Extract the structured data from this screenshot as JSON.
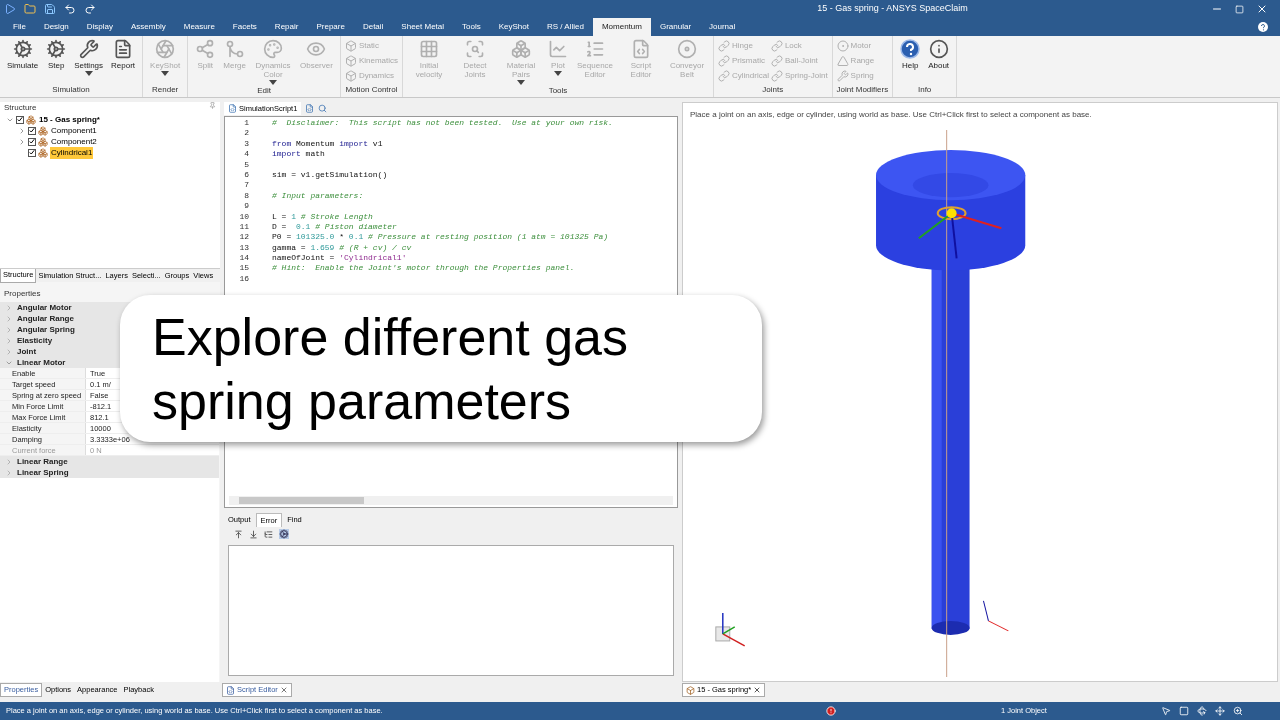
{
  "title_bar": {
    "title": "15 - Gas spring - ANSYS SpaceClaim"
  },
  "menu_tabs": [
    {
      "label": "File",
      "selected": false
    },
    {
      "label": "Design",
      "selected": false
    },
    {
      "label": "Display",
      "selected": false
    },
    {
      "label": "Assembly",
      "selected": false
    },
    {
      "label": "Measure",
      "selected": false
    },
    {
      "label": "Facets",
      "selected": false
    },
    {
      "label": "Repair",
      "selected": false
    },
    {
      "label": "Prepare",
      "selected": false
    },
    {
      "label": "Detail",
      "selected": false
    },
    {
      "label": "Sheet Metal",
      "selected": false
    },
    {
      "label": "Tools",
      "selected": false
    },
    {
      "label": "KeyShot",
      "selected": false
    },
    {
      "label": "RS / Allied",
      "selected": false
    },
    {
      "label": "Momentum",
      "selected": true
    },
    {
      "label": "Granular",
      "selected": false
    },
    {
      "label": "Journal",
      "selected": false
    }
  ],
  "ribbon_groups": [
    {
      "label": "Simulation",
      "columns": [
        [
          {
            "label": "Simulate",
            "kind": "large",
            "disabled": false,
            "dropdown": false
          }
        ],
        [
          {
            "label": "Step",
            "kind": "large",
            "disabled": false,
            "dropdown": false
          }
        ],
        [
          {
            "label": "Settings",
            "kind": "large",
            "disabled": false,
            "dropdown": true
          }
        ],
        [
          {
            "label": "Report",
            "kind": "large",
            "disabled": false,
            "dropdown": false
          }
        ]
      ]
    },
    {
      "label": "Render",
      "columns": [
        [
          {
            "label": "KeyShot",
            "kind": "large",
            "disabled": true,
            "dropdown": true
          }
        ]
      ]
    },
    {
      "label": "Edit",
      "columns": [
        [
          {
            "label": "Split",
            "kind": "large",
            "disabled": true,
            "dropdown": false
          }
        ],
        [
          {
            "label": "Merge",
            "kind": "large",
            "disabled": true,
            "dropdown": false
          }
        ],
        [
          {
            "label": "Dynamics Color",
            "kind": "large",
            "disabled": true,
            "dropdown": true
          }
        ],
        [
          {
            "label": "Observer",
            "kind": "large",
            "disabled": true,
            "dropdown": false
          }
        ]
      ]
    },
    {
      "label": "Motion Control",
      "columns": [
        [
          {
            "label": "Static",
            "kind": "small",
            "disabled": true
          },
          {
            "label": "Kinematics",
            "kind": "small",
            "disabled": true
          },
          {
            "label": "Dynamics",
            "kind": "small",
            "disabled": true
          }
        ]
      ]
    },
    {
      "label": "Tools",
      "columns": [
        [
          {
            "label": "Initial velocity",
            "kind": "large",
            "disabled": true,
            "dropdown": false
          }
        ],
        [
          {
            "label": "Detect Joints",
            "kind": "large",
            "disabled": true,
            "dropdown": false
          }
        ],
        [
          {
            "label": "Material Pairs",
            "kind": "large",
            "disabled": true,
            "dropdown": true
          }
        ],
        [
          {
            "label": "Plot",
            "kind": "large",
            "disabled": true,
            "dropdown": true
          }
        ],
        [
          {
            "label": "Sequence Editor",
            "kind": "large",
            "disabled": true,
            "dropdown": false
          }
        ],
        [
          {
            "label": "Script Editor",
            "kind": "large",
            "disabled": true,
            "dropdown": false
          }
        ],
        [
          {
            "label": "Conveyor Belt",
            "kind": "large",
            "disabled": true,
            "dropdown": false
          }
        ]
      ]
    },
    {
      "label": "Joints",
      "columns": [
        [
          {
            "label": "Hinge",
            "kind": "small",
            "disabled": true
          },
          {
            "label": "Prismatic",
            "kind": "small",
            "disabled": true
          },
          {
            "label": "Cylindrical",
            "kind": "small",
            "disabled": true
          }
        ],
        [
          {
            "label": "Lock",
            "kind": "small",
            "disabled": true
          },
          {
            "label": "Ball-Joint",
            "kind": "small",
            "disabled": true
          },
          {
            "label": "Spring-Joint",
            "kind": "small",
            "disabled": true
          }
        ]
      ]
    },
    {
      "label": "Joint Modifiers",
      "columns": [
        [
          {
            "label": "Motor",
            "kind": "small",
            "disabled": true
          },
          {
            "label": "Range",
            "kind": "small",
            "disabled": true
          },
          {
            "label": "Spring",
            "kind": "small",
            "disabled": true
          }
        ]
      ]
    },
    {
      "label": "Info",
      "columns": [
        [
          {
            "label": "Help",
            "kind": "large",
            "disabled": false,
            "dropdown": false
          }
        ],
        [
          {
            "label": "About",
            "kind": "large",
            "disabled": false,
            "dropdown": false
          }
        ]
      ]
    }
  ],
  "structure": {
    "title": "Structure",
    "tree": [
      {
        "label": "15 - Gas spring*",
        "checked": true,
        "expanded": true,
        "selected": false,
        "children": [
          {
            "label": "Component1",
            "checked": true,
            "expanded": false,
            "selected": false
          },
          {
            "label": "Component2",
            "checked": true,
            "expanded": false,
            "selected": false
          },
          {
            "label": "Cylindrical1",
            "checked": true,
            "selected": true
          }
        ]
      }
    ],
    "tabs": [
      {
        "label": "Structure",
        "selected": true
      },
      {
        "label": "Simulation Struct...",
        "selected": false
      },
      {
        "label": "Layers",
        "selected": false
      },
      {
        "label": "Selecti...",
        "selected": false
      },
      {
        "label": "Groups",
        "selected": false
      },
      {
        "label": "Views",
        "selected": false
      }
    ]
  },
  "properties": {
    "title": "Properties",
    "groups": [
      {
        "label": "Angular Motor",
        "expanded": false
      },
      {
        "label": "Angular Range",
        "expanded": false
      },
      {
        "label": "Angular Spring",
        "expanded": false
      },
      {
        "label": "Elasticity",
        "expanded": false
      },
      {
        "label": "Joint",
        "expanded": false
      },
      {
        "label": "Linear Motor",
        "expanded": true,
        "rows": [
          {
            "name": "Enable",
            "value": "True",
            "disabled": false
          },
          {
            "name": "Target speed",
            "value": "0.1 m/",
            "disabled": false
          },
          {
            "name": "Spring at zero speed",
            "value": "False",
            "disabled": false
          },
          {
            "name": "Min Force Limit",
            "value": "-812.1",
            "disabled": false
          },
          {
            "name": "Max Force Limit",
            "value": "812.1",
            "disabled": false
          },
          {
            "name": "Elasticity",
            "value": "10000",
            "disabled": false
          },
          {
            "name": "Damping",
            "value": "3.3333e+06",
            "disabled": false
          },
          {
            "name": "Current force",
            "value": "0 N",
            "disabled": true
          }
        ]
      },
      {
        "label": "Linear Range",
        "expanded": false
      },
      {
        "label": "Linear Spring",
        "expanded": false
      }
    ]
  },
  "script_editor": {
    "tab": "SimulationScript1",
    "lines": [
      {
        "number": "1",
        "tokens": [
          {
            "kind": "comment",
            "text": "#  Disclaimer:  This script has not been tested.  Use at your own risk."
          }
        ]
      },
      {
        "number": "2"
      },
      {
        "number": "3",
        "tokens": [
          {
            "kind": "keyword",
            "text": "from"
          },
          {
            "kind": "plain",
            "text": " Momentum "
          },
          {
            "kind": "keyword",
            "text": "import"
          },
          {
            "kind": "plain",
            "text": " v1"
          }
        ]
      },
      {
        "number": "4",
        "tokens": [
          {
            "kind": "keyword",
            "text": "import"
          },
          {
            "kind": "plain",
            "text": " math"
          }
        ]
      },
      {
        "number": "5"
      },
      {
        "number": "6",
        "tokens": [
          {
            "kind": "plain",
            "text": "sim = v1.getSimulation()"
          }
        ]
      },
      {
        "number": "7"
      },
      {
        "number": "8",
        "tokens": [
          {
            "kind": "comment",
            "text": "# Input parameters:"
          }
        ]
      },
      {
        "number": "9"
      },
      {
        "number": "10",
        "tokens": [
          {
            "kind": "plain",
            "text": "L = "
          },
          {
            "kind": "number",
            "text": "1"
          },
          {
            "kind": "comment",
            "text": " # Stroke Length"
          }
        ]
      },
      {
        "number": "11",
        "tokens": [
          {
            "kind": "plain",
            "text": "D =  "
          },
          {
            "kind": "number",
            "text": "0.1"
          },
          {
            "kind": "comment",
            "text": " # Piston diameter"
          }
        ]
      },
      {
        "number": "12",
        "tokens": [
          {
            "kind": "plain",
            "text": "P0 = "
          },
          {
            "kind": "number",
            "text": "101325.0"
          },
          {
            "kind": "plain",
            "text": " * "
          },
          {
            "kind": "number",
            "text": "0.1"
          },
          {
            "kind": "comment",
            "text": " # Pressure at resting position (1 atm = 101325 Pa)"
          }
        ]
      },
      {
        "number": "13",
        "tokens": [
          {
            "kind": "plain",
            "text": "gamma = "
          },
          {
            "kind": "number",
            "text": "1.659"
          },
          {
            "kind": "comment",
            "text": " # (R + cv) / cv"
          }
        ]
      },
      {
        "number": "14",
        "tokens": [
          {
            "kind": "plain",
            "text": "nameOfJoint = "
          },
          {
            "kind": "string",
            "text": "'Cylindrical1'"
          }
        ]
      },
      {
        "number": "15",
        "tokens": [
          {
            "kind": "comment",
            "text": "# Hint:  Enable the Joint's motor through the Properties panel."
          }
        ]
      },
      {
        "number": "16"
      }
    ]
  },
  "output": {
    "tabs": [
      {
        "label": "Output",
        "selected": false
      },
      {
        "label": "Error",
        "selected": true
      },
      {
        "label": "Find",
        "selected": false
      }
    ]
  },
  "viewport": {
    "hint": "Place a joint on an axis, edge or cylinder, using world as base. Use Ctrl+Click first to select a component as base."
  },
  "caption": "Explore different gas spring parameters",
  "bottom_tabs": {
    "left": [
      {
        "label": "Properties",
        "selected": true
      },
      {
        "label": "Options",
        "selected": false
      },
      {
        "label": "Appearance",
        "selected": false
      },
      {
        "label": "Playback",
        "selected": false
      }
    ],
    "middle": "Script Editor",
    "right": "15 - Gas spring*"
  },
  "status_bar": {
    "message": "Place a joint on an axis, edge or cylinder, using world as base. Use Ctrl+Click first to select a component as base.",
    "selection": "1 Joint Object"
  }
}
